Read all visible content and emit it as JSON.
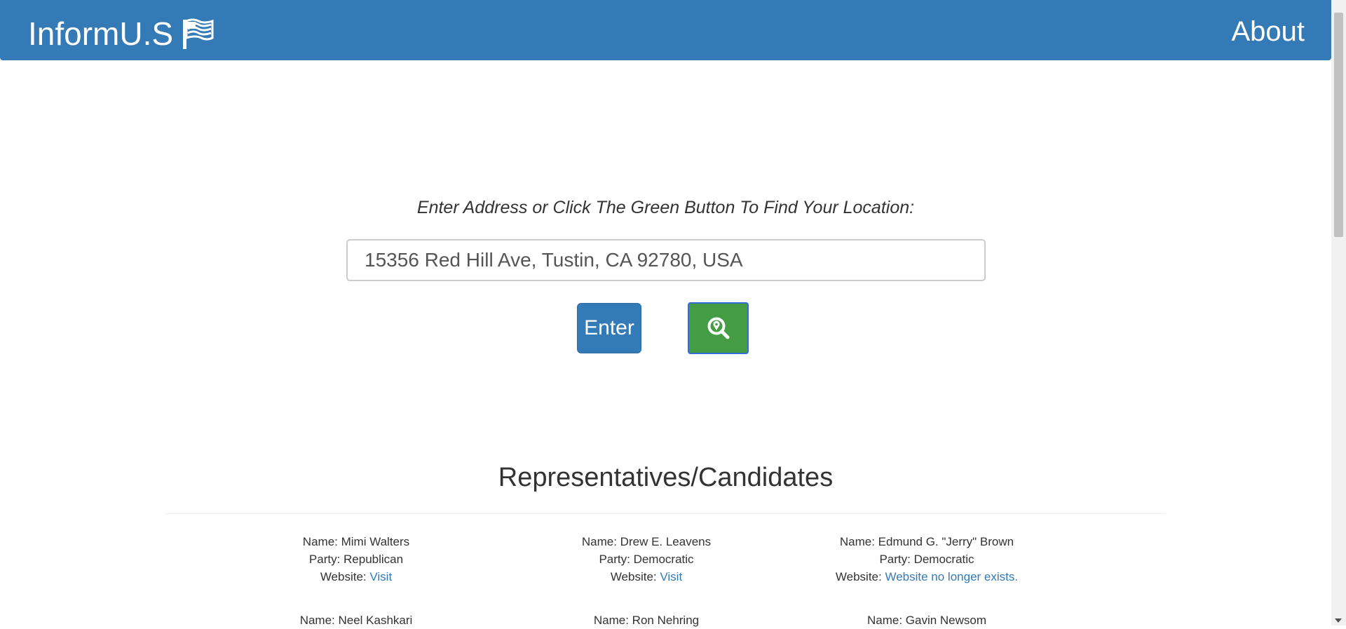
{
  "navbar": {
    "brand": "InformU.S",
    "about": "About",
    "color": "#337ab7"
  },
  "search": {
    "prompt": "Enter Address or Click The Green Button To Find Your Location:",
    "value": "15356 Red Hill Ave, Tustin, CA 92780, USA",
    "enter_label": "Enter",
    "locate_icon": "map-pin-magnifier-icon",
    "locate_color": "#449d44"
  },
  "section": {
    "title": "Representatives/Candidates"
  },
  "labels": {
    "name": "Name: ",
    "party": "Party: ",
    "website": "Website: "
  },
  "representatives": [
    {
      "name": "Mimi Walters",
      "party": "Republican",
      "website": "Visit"
    },
    {
      "name": "Drew E. Leavens",
      "party": "Democratic",
      "website": "Visit"
    },
    {
      "name": "Edmund G. \"Jerry\" Brown",
      "party": "Democratic",
      "website": "Website no longer exists."
    },
    {
      "name": "Neel Kashkari"
    },
    {
      "name": "Ron Nehring"
    },
    {
      "name": "Gavin Newsom"
    }
  ]
}
